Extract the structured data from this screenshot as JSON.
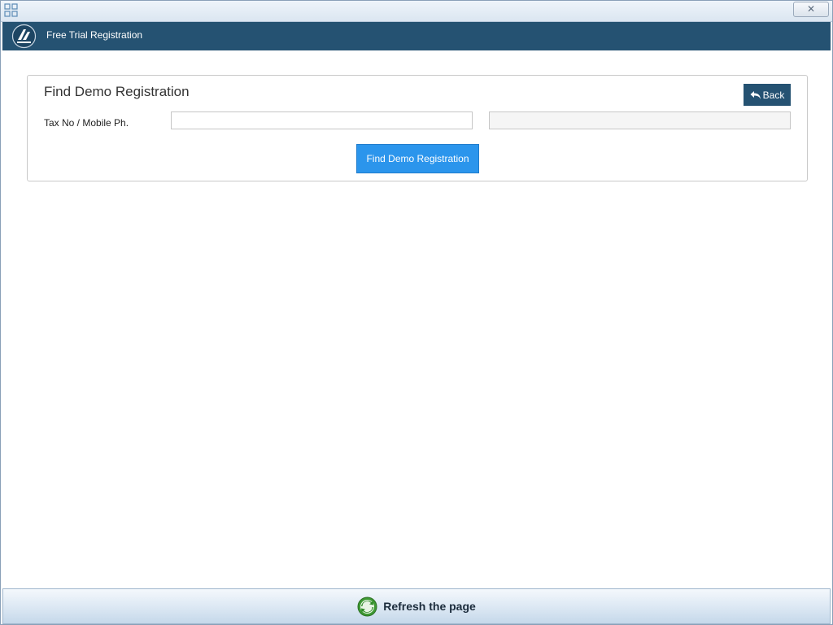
{
  "window": {
    "close_label": "✕",
    "app_icon": "app-grid-icon"
  },
  "header": {
    "title": "Free Trial Registration",
    "logo": "company-logo-icon"
  },
  "panel": {
    "title": "Find Demo Registration",
    "back_label": "Back",
    "field_label": "Tax No / Mobile Ph.",
    "input_value": "",
    "secondary_value": "",
    "find_label": "Find Demo Registration"
  },
  "footer": {
    "refresh_label": "Refresh the page",
    "refresh_icon": "refresh-icon"
  },
  "colors": {
    "header_bg": "#255272",
    "accent_button": "#2b95ec",
    "back_button": "#255272"
  }
}
